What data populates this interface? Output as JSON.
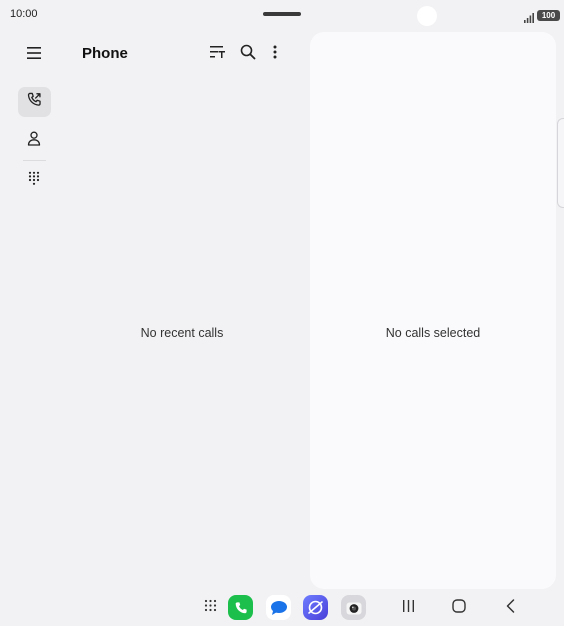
{
  "status_bar": {
    "time": "10:00",
    "battery": "100"
  },
  "header": {
    "title": "Phone",
    "icons": [
      "menu-icon",
      "sort-filter-icon",
      "search-icon",
      "more-options-icon"
    ]
  },
  "nav_rail": {
    "items": [
      {
        "name": "recents",
        "icon": "call-log-icon",
        "selected": true
      },
      {
        "name": "contacts",
        "icon": "person-icon",
        "selected": false
      },
      {
        "name": "keypad",
        "icon": "keypad-icon",
        "selected": false
      }
    ]
  },
  "list": {
    "empty_text": "No recent calls"
  },
  "detail": {
    "empty_text": "No calls selected"
  },
  "taskbar": {
    "apps": [
      "apps-grid-icon",
      "phone-app-icon",
      "messages-app-icon",
      "internet-app-icon",
      "camera-app-icon"
    ],
    "nav": [
      "recent-apps-icon",
      "home-icon",
      "back-icon"
    ]
  },
  "colors": {
    "background": "#f2f2f4",
    "pane": "#fafafc",
    "phone_app": "#1dbf4c",
    "internet_app": "#5a5cf0"
  }
}
